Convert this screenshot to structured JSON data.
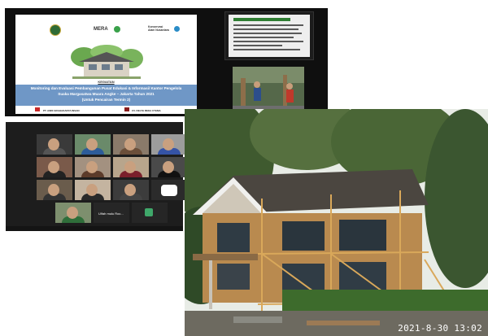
{
  "slide": {
    "brand_center": "MERA",
    "brand_right_line1": "Konservasi",
    "brand_right_line2": "Alam Nusantara",
    "kegiatan_label": "KEGIATAN",
    "title_line1": "Monitoring dan Evaluasi Pembangunan Pusat Edukasi & Informasi/ Kantor Pengelola",
    "title_line2": "Suaka Margasatwa Muara Angke – Jakarta Tahun 2021",
    "title_line3": "(Untuk Pencairan Termin 2)",
    "footer_left": "PT. ANDI GRAHAKARYA INSAN",
    "footer_right": "CV. DELTA REKA UTAMA"
  },
  "zoom": {
    "tile_name": "Ulfah mulu Roc..."
  },
  "photo": {
    "timestamp": "2021-8-30 13:02"
  },
  "colors": {
    "slide_band": "#6f97c6",
    "roof": "#4b4640",
    "wood": "#b98a4f"
  }
}
